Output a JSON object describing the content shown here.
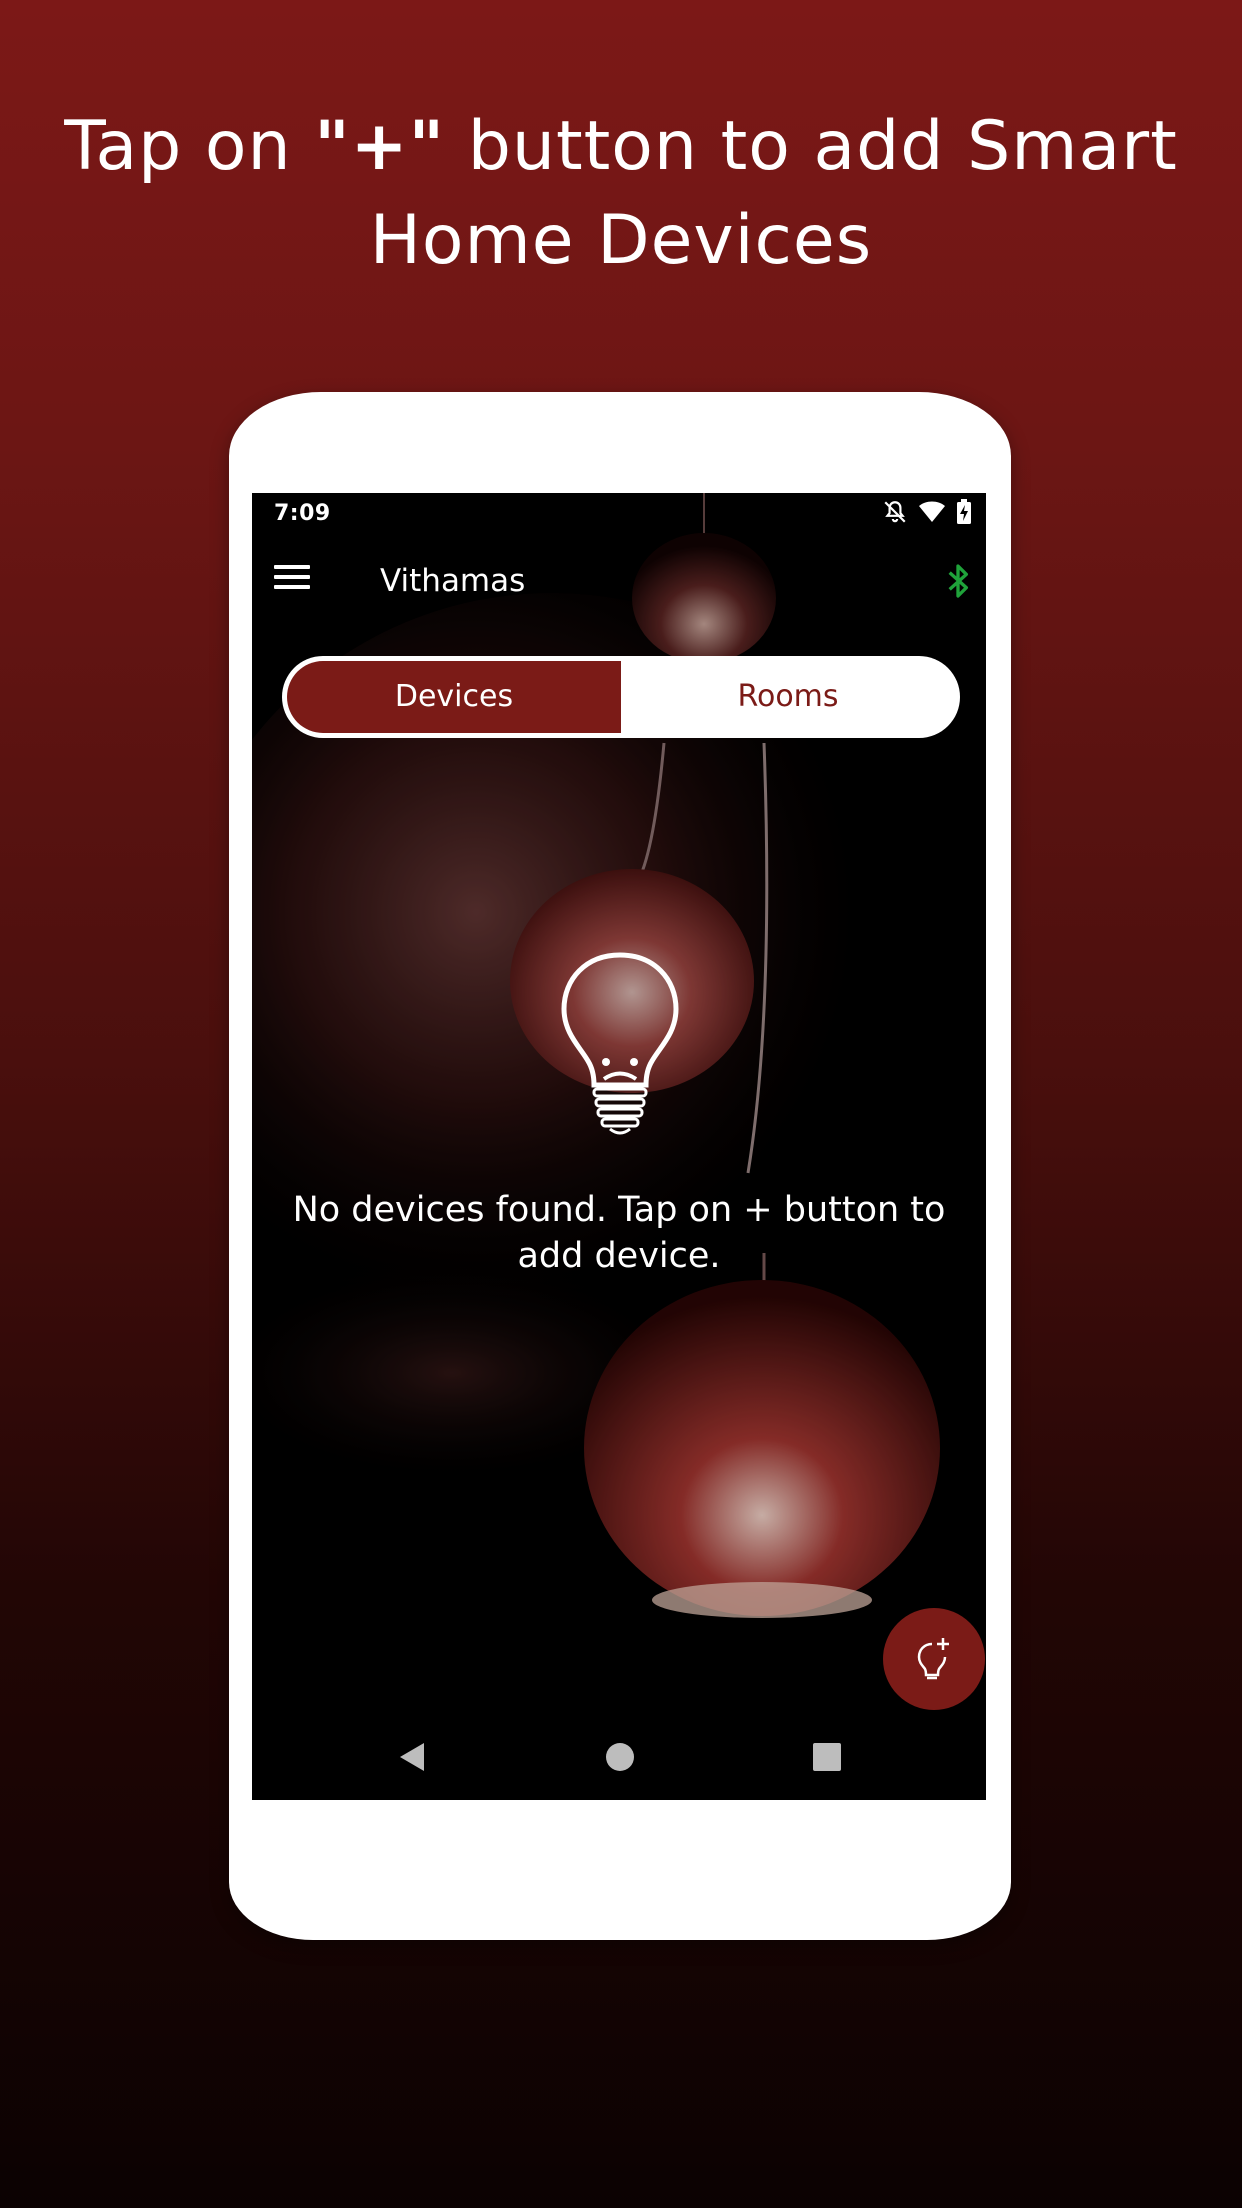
{
  "headline": {
    "part1": "Tap on ",
    "part2": "\"+\"",
    "part3": " button to add Smart Home Devices"
  },
  "status_bar": {
    "time": "7:09",
    "icons": [
      "notifications-off-icon",
      "wifi-icon",
      "battery-charging-icon"
    ]
  },
  "app_bar": {
    "title": "Vithamas",
    "menu_icon": "hamburger-menu-icon",
    "bluetooth_icon": "bluetooth-icon",
    "bluetooth_color": "#1fa33a"
  },
  "tabs": [
    {
      "label": "Devices",
      "selected": true
    },
    {
      "label": "Rooms",
      "selected": false
    }
  ],
  "empty_state": {
    "icon": "sad-lightbulb-icon",
    "message": "No devices found. Tap on + button to add device."
  },
  "fab": {
    "icon": "add-bulb-icon"
  },
  "nav_bar": {
    "icons": [
      "back-icon",
      "home-icon",
      "recent-apps-icon"
    ]
  },
  "colors": {
    "accent": "#7b1b17",
    "background_top": "#7c1817",
    "background_bottom": "#0b0202",
    "text": "#ffffff"
  }
}
